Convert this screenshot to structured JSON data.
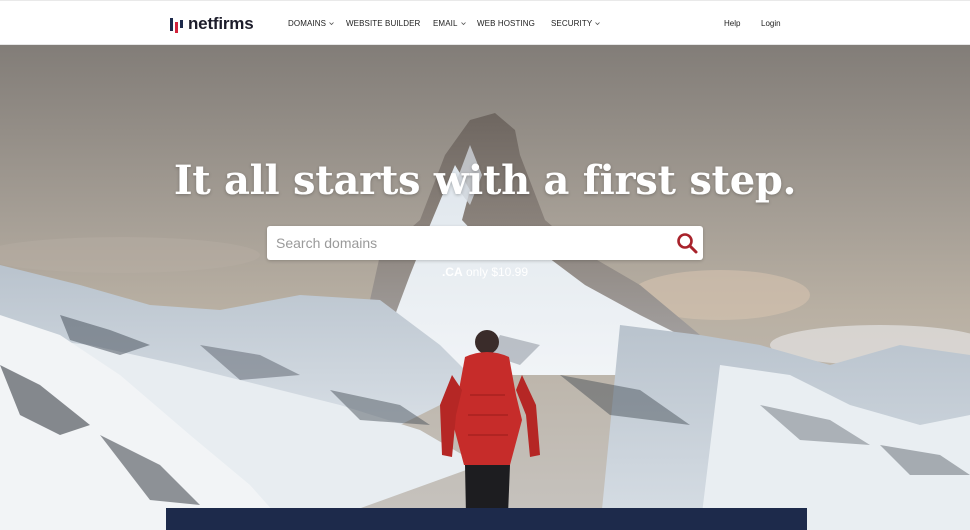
{
  "brand": {
    "name": "netfirms",
    "colors": {
      "red": "#d3223a",
      "navy": "#1d2a4b"
    }
  },
  "nav": {
    "items": [
      {
        "label": "DOMAINS",
        "has_dropdown": true
      },
      {
        "label": "WEBSITE BUILDER",
        "has_dropdown": false
      },
      {
        "label": "EMAIL",
        "has_dropdown": true
      },
      {
        "label": "WEB HOSTING",
        "has_dropdown": false
      },
      {
        "label": "SECURITY",
        "has_dropdown": true
      }
    ],
    "help": "Help",
    "login": "Login"
  },
  "hero": {
    "title": "It all starts with a first step.",
    "search_placeholder": "Search domains",
    "search_icon": "search-icon",
    "promo_tld": ".CA",
    "promo_text": "only $10.99"
  }
}
